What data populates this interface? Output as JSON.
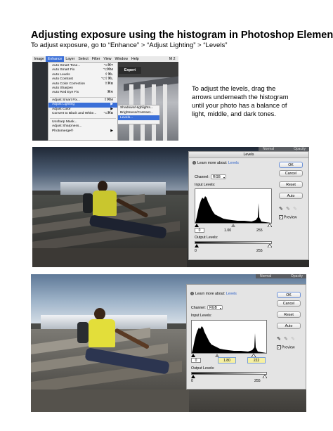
{
  "title": "Adjusting exposure using the histogram in Photoshop Elements",
  "subtitle": "To adjust exposure, go to “Enhance” > “Adjust Lighting” > “Levels”",
  "instruction": "To adjust the levels, drag the arrows underneath the histogram until your photo has a balance of light, middle, and dark tones.",
  "menubar": {
    "items": [
      "Image",
      "Enhance",
      "Layer",
      "Select",
      "Filter",
      "View",
      "Window",
      "Help"
    ],
    "selected": "Enhance",
    "right_text": "M 2"
  },
  "expert_tab": "Expert",
  "enhance_menu": [
    {
      "label": "Auto Smart Tone...",
      "shortcut": "⌥⌘T"
    },
    {
      "label": "Auto Smart Fix",
      "shortcut": "⌥⌘M"
    },
    {
      "label": "Auto Levels",
      "shortcut": "⇧⌘L"
    },
    {
      "label": "Auto Contrast",
      "shortcut": "⌥⇧⌘L"
    },
    {
      "label": "Auto Color Correction",
      "shortcut": "⇧⌘B"
    },
    {
      "label": "Auto Sharpen",
      "shortcut": ""
    },
    {
      "label": "Auto Red Eye Fix",
      "shortcut": "⌘R"
    },
    {
      "label": "Adjust Smart Fix...",
      "shortcut": "⇧⌘M"
    },
    {
      "label": "Adjust Lighting",
      "shortcut": "▶"
    },
    {
      "label": "Adjust Color",
      "shortcut": "▶"
    },
    {
      "label": "Convert to Black and White...",
      "shortcut": "⌥⌘B"
    },
    {
      "label": "Unsharp Mask...",
      "shortcut": ""
    },
    {
      "label": "Adjust Sharpness...",
      "shortcut": ""
    },
    {
      "label": "Photomerge®",
      "shortcut": "▶"
    }
  ],
  "submenu": [
    "Shadows/Highlights...",
    "Brightness/Contrast...",
    "Levels..."
  ],
  "dialog1": {
    "window_title": "Levels",
    "learn_prefix": "Learn more about:",
    "learn_link": "Levels",
    "channel_label": "Channel:",
    "channel_value": "RGB",
    "input_levels_label": "Input Levels:",
    "input_black": "0",
    "input_mid": "1.00",
    "input_white": "255",
    "output_levels_label": "Output Levels:",
    "output_black": "0",
    "output_white": "255",
    "buttons": [
      "OK",
      "Cancel",
      "Reset",
      "Auto"
    ],
    "preview_label": "Preview",
    "toolbar_left": "Normal",
    "toolbar_right": "Opacity"
  },
  "dialog2": {
    "learn_prefix": "Learn more about:",
    "learn_link": "Levels",
    "channel_label": "Channel:",
    "channel_value": "RGB",
    "input_levels_label": "Input Levels:",
    "input_black": "0",
    "input_mid": "1.80",
    "input_white": "222",
    "output_levels_label": "Output Levels:",
    "output_black": "0",
    "output_white": "255",
    "buttons": [
      "OK",
      "Cancel",
      "Reset",
      "Auto"
    ],
    "preview_label": "Preview",
    "toolbar_left": "Normal",
    "toolbar_right": "Opacity"
  }
}
